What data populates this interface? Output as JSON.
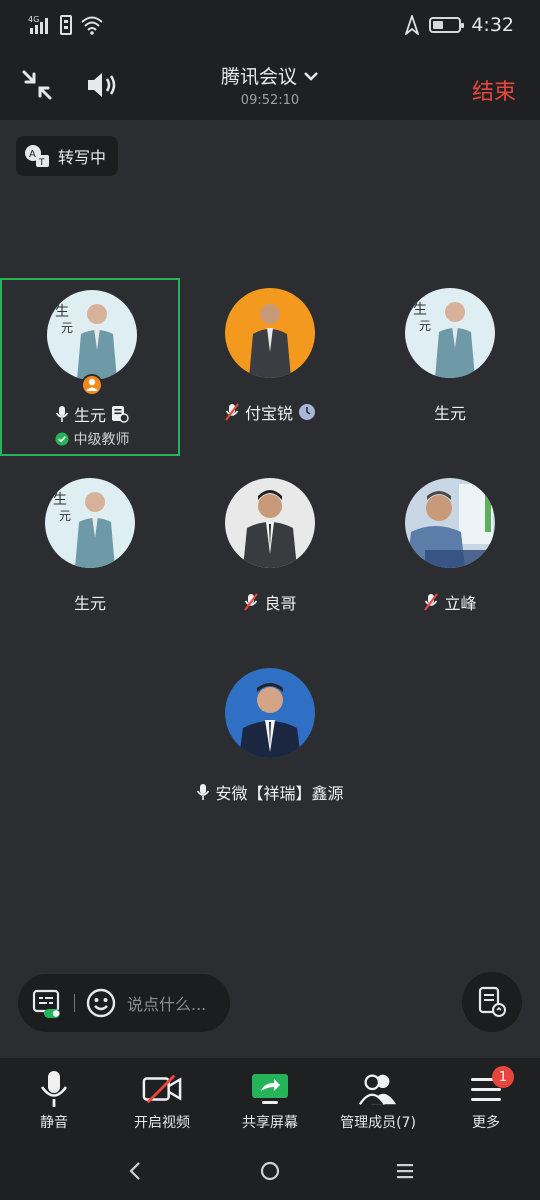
{
  "status_bar": {
    "network": "4G",
    "time": "4:32",
    "battery_level": 0.4
  },
  "header": {
    "title": "腾讯会议",
    "timer": "09:52:10",
    "end_label": "结束"
  },
  "transcribe": {
    "label": "转写中"
  },
  "participants": [
    {
      "name": "生元",
      "title": "中级教师",
      "mic": "on",
      "host": true,
      "note": true,
      "active": true,
      "avatar": "poster"
    },
    {
      "name": "付宝锐",
      "mic": "muted",
      "clock": true,
      "avatar": "orange"
    },
    {
      "name": "生元",
      "avatar": "poster"
    },
    {
      "name": "生元",
      "avatar": "poster"
    },
    {
      "name": "良哥",
      "mic": "muted",
      "avatar": "suit-gray"
    },
    {
      "name": "立峰",
      "mic": "muted",
      "avatar": "lecture"
    },
    {
      "name": "安微【祥瑞】鑫源",
      "mic": "on",
      "avatar": "blue"
    }
  ],
  "chat": {
    "placeholder": "说点什么..."
  },
  "toolbar": {
    "mute": "静音",
    "video": "开启视频",
    "share": "共享屏幕",
    "members": "管理成员(7)",
    "more": "更多",
    "more_badge": "1"
  },
  "colors": {
    "accent_green": "#25b45a",
    "end_red": "#e8453c",
    "host_orange": "#f28a20"
  }
}
